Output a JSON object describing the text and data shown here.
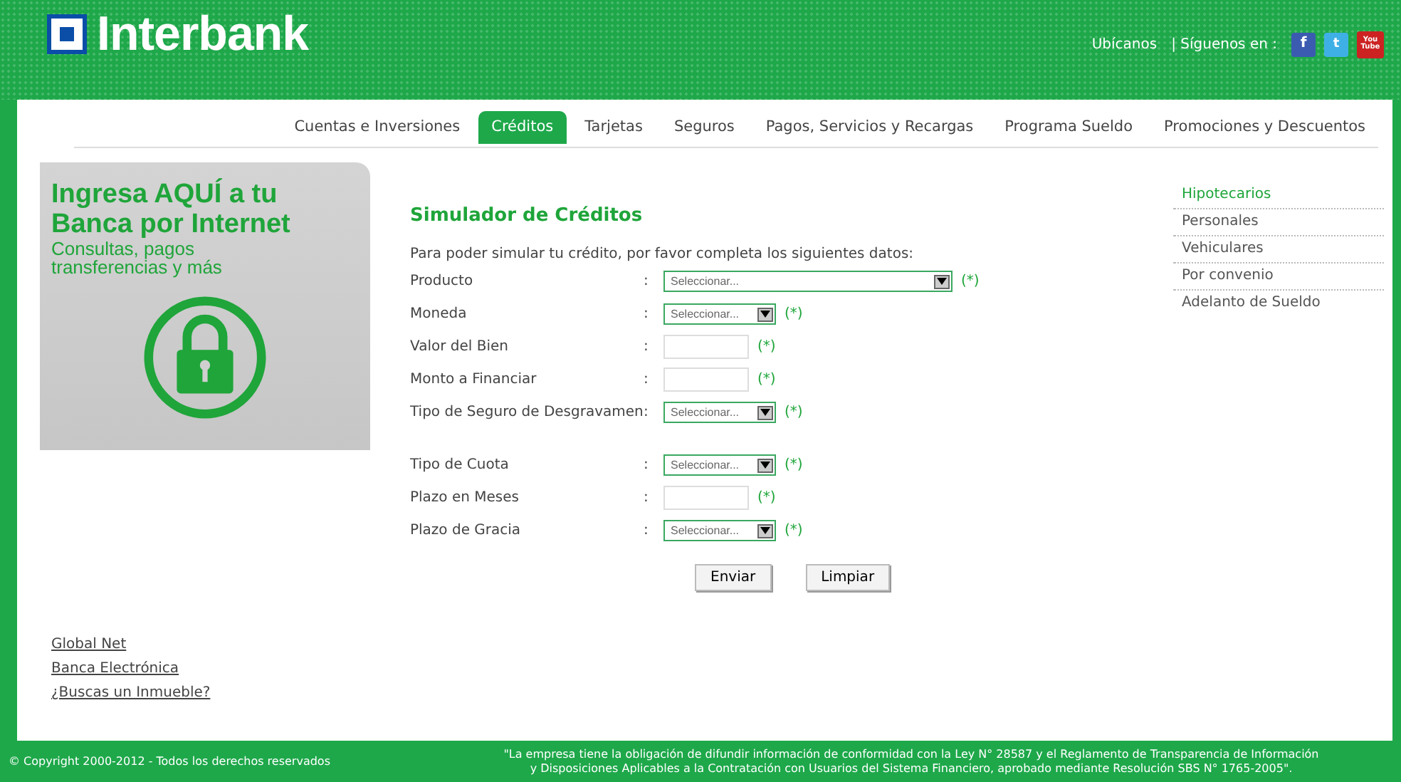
{
  "header": {
    "logo": "Interbank",
    "links": [
      "Ubícanos",
      "| Síguenos en :"
    ],
    "social": [
      "f",
      "t",
      "You Tube"
    ]
  },
  "nav": [
    {
      "label": "Cuentas e Inversiones",
      "selected": false
    },
    {
      "label": "Créditos",
      "selected": true
    },
    {
      "label": "Tarjetas",
      "selected": false
    },
    {
      "label": "Seguros",
      "selected": false
    },
    {
      "label": "Pagos, Servicios y Recargas",
      "selected": false
    },
    {
      "label": "Programa Sueldo",
      "selected": false
    },
    {
      "label": "Promociones y Descuentos",
      "selected": false
    }
  ],
  "banner": {
    "title": "Ingresa AQUÍ a tu Banca por Internet",
    "subtitle": "Consultas, pagos transferencias y más"
  },
  "left_links": [
    "Global Net",
    "Banca Electrónica",
    "¿Buscas un Inmueble?"
  ],
  "form": {
    "title": "Simulador de Créditos",
    "intro": "Para poder simular tu crédito, por favor completa los siguientes datos:",
    "groups": [
      [
        {
          "label": "Producto",
          "separator": ":",
          "kind": "select",
          "wide": true,
          "placeholder": "Seleccionar...",
          "required": "(*)"
        },
        {
          "label": "Moneda",
          "separator": ":",
          "kind": "select",
          "wide": false,
          "placeholder": "Seleccionar...",
          "required": "(*)"
        },
        {
          "label": "Valor del Bien",
          "separator": ":",
          "kind": "text",
          "required": "(*)"
        },
        {
          "label": "Monto a Financiar",
          "separator": ":",
          "kind": "text",
          "required": "(*)"
        },
        {
          "label": "Tipo de Seguro de Desgravamen",
          "separator": ":",
          "kind": "select",
          "wide": false,
          "placeholder": "Seleccionar...",
          "required": "(*)"
        }
      ],
      [
        {
          "label": "Tipo de Cuota",
          "separator": ":",
          "kind": "select",
          "wide": false,
          "placeholder": "Seleccionar...",
          "required": "(*)"
        },
        {
          "label": "Plazo en Meses",
          "separator": ":",
          "kind": "text",
          "required": "(*)"
        },
        {
          "label": "Plazo de Gracia",
          "separator": ":",
          "kind": "select",
          "wide": false,
          "placeholder": "Seleccionar...",
          "required": "(*)"
        }
      ]
    ],
    "buttons": [
      "Enviar",
      "Limpiar"
    ]
  },
  "sidebar": [
    {
      "label": "Hipotecarios",
      "selected": true
    },
    {
      "label": "Personales",
      "selected": false
    },
    {
      "label": "Vehiculares",
      "selected": false
    },
    {
      "label": "Por convenio",
      "selected": false
    },
    {
      "label": "Adelanto de Sueldo",
      "selected": false
    }
  ],
  "footer": {
    "copyright": "© Copyright 2000-2012 - Todos los derechos reservados",
    "legal": [
      "\"La empresa tiene la obligación de difundir información de conformidad con la Ley N° 28587 y el Reglamento de Transparencia de Información",
      "y Disposiciones Aplicables a la Contratación con Usuarios del Sistema Financiero, aprobado mediante Resolución SBS N° 1765-2005\"."
    ]
  }
}
